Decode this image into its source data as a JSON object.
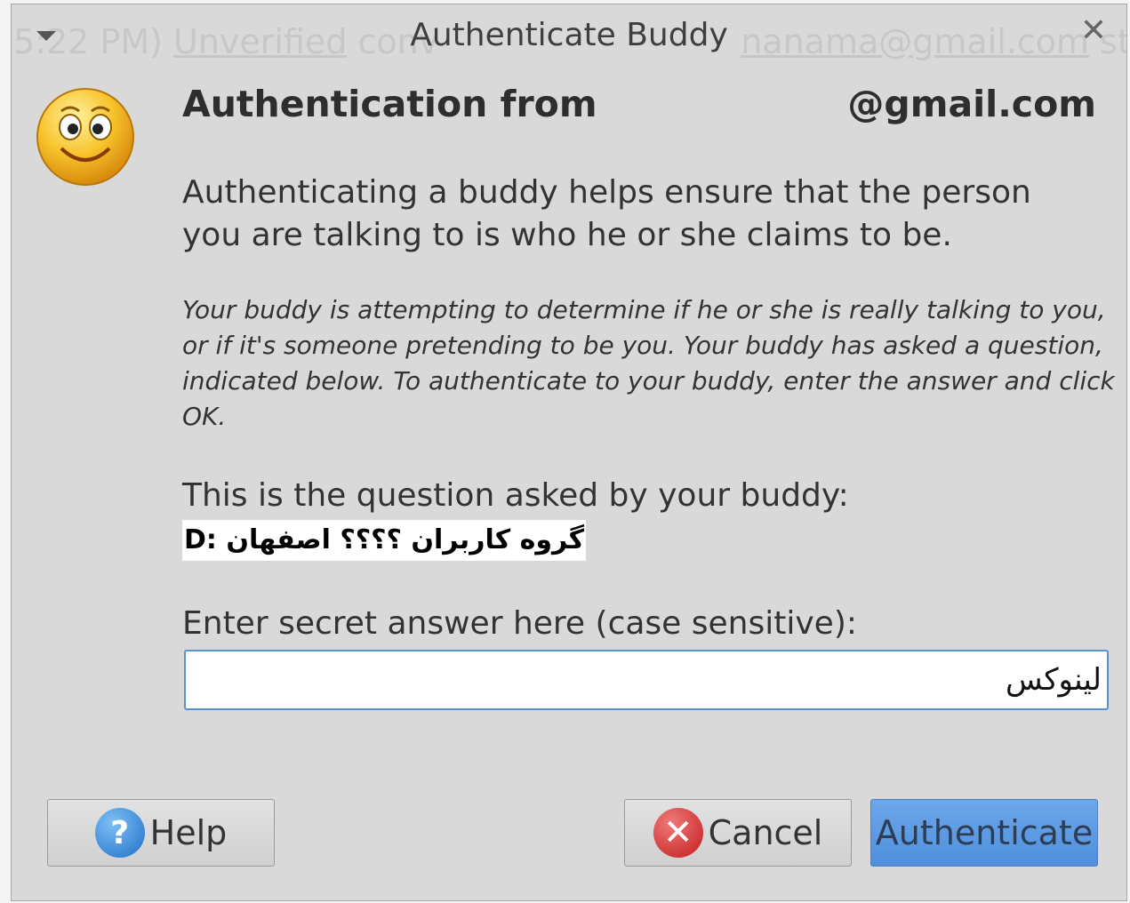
{
  "window": {
    "background_text_prefix": "5:22 PM) ",
    "background_text_link1": "Unverified",
    "background_text_mid": " conv",
    "background_text_link2": "nanama@gmail.com",
    "background_text_end": " start",
    "title": "Authenticate Buddy",
    "close_glyph": "✕"
  },
  "header": {
    "title_left": "Authentication from",
    "title_right": "@gmail.com"
  },
  "body": {
    "description": "Authenticating a buddy helps ensure that the person you are talking to is who he or she claims to be.",
    "italic_description": "Your buddy is attempting to determine if he or she is really talking to you, or if it's someone pretending to be you.  Your buddy has asked a question, indicated below.  To authenticate to your buddy, enter the answer and click OK.",
    "question_label": "This is the question asked by your buddy:",
    "question_value": "گروه کاربران ؟؟؟؟ اصفهان :D",
    "answer_label": "Enter secret answer here (case sensitive):",
    "answer_value": "لینوکس"
  },
  "buttons": {
    "help_label": "Help",
    "cancel_label": "Cancel",
    "authenticate_label": "Authenticate"
  },
  "icons": {
    "avatar": "smiley-icon",
    "help": "question-circle-icon",
    "cancel": "x-circle-icon"
  },
  "colors": {
    "accent": "#5c8fd0",
    "authenticate_button": "#5a97e0",
    "window_bg": "#d9d9d9"
  }
}
